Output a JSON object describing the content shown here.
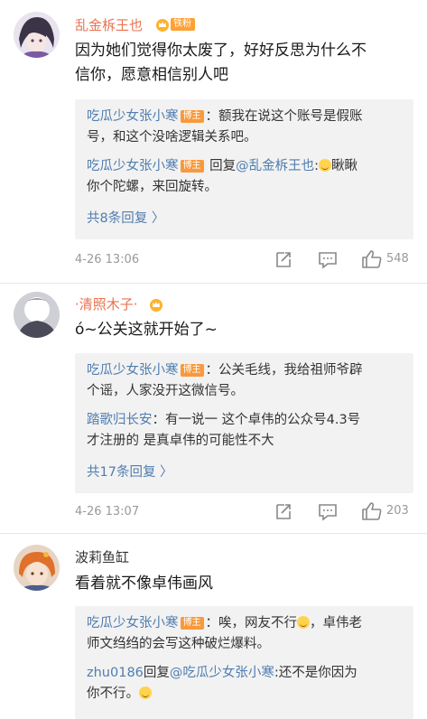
{
  "comments": [
    {
      "username": "乱金柝王也",
      "badge_label": "铁粉",
      "text_line1": "因为她们觉得你太废了，好好反思为什么不",
      "text_line2": "信你，愿意相信别人吧",
      "replies": [
        {
          "name": "吃瓜少女张小寒",
          "host_badge": "博主",
          "line1_text": "：额我在说这个账号是假账",
          "line2_text": "号，和这个没啥逻辑关系吧。"
        },
        {
          "name": "吃瓜少女张小寒",
          "host_badge": "博主",
          "reply_word": " 回复",
          "target": "@乱金柝王也",
          "line1_text": ":瞅瞅",
          "line2_text": "你个陀螺，来回旋转。"
        }
      ],
      "more_label": "共8条回复 〉",
      "time": "4-26 13:06",
      "likes": "548"
    },
    {
      "username": "·清照木子·",
      "text_line1": "ó~公关这就开始了~",
      "replies": [
        {
          "name": "吃瓜少女张小寒",
          "host_badge": "博主",
          "line1_text": "：公关毛线，我给祖师爷辟",
          "line2_text": "个谣，人家没开这微信号。"
        },
        {
          "name": "踏歌归长安",
          "line1_text": "：有一说一  这个卓伟的公众号4.3号",
          "line2_text": "才注册的  是真卓伟的可能性不大"
        }
      ],
      "more_label": "共17条回复 〉",
      "time": "4-26 13:07",
      "likes": "203"
    },
    {
      "username": "波莉鱼缸",
      "text_line1": "看着就不像卓伟画风",
      "replies": [
        {
          "name": "吃瓜少女张小寒",
          "host_badge": "博主",
          "line1_text": "：唉，网友不行",
          "line1_tail": "，卓伟老",
          "line2_text": "师文绉绉的会写这种破烂爆料。"
        },
        {
          "name": "zhu0186",
          "reply_word": "回复",
          "target": "@吃瓜少女张小寒",
          "line1_text": ":还不是你因为",
          "line2_text": "你不行。"
        }
      ]
    }
  ],
  "colors": {
    "username_orange": "#eb7350",
    "link_blue": "#507daf",
    "host_badge": "#f89a3c",
    "fan_badge": "#ffa033",
    "reply_bg": "#f2f2f2"
  },
  "icons": [
    "share-icon",
    "comment-icon",
    "like-icon",
    "crown-icon",
    "smile-emoji"
  ]
}
